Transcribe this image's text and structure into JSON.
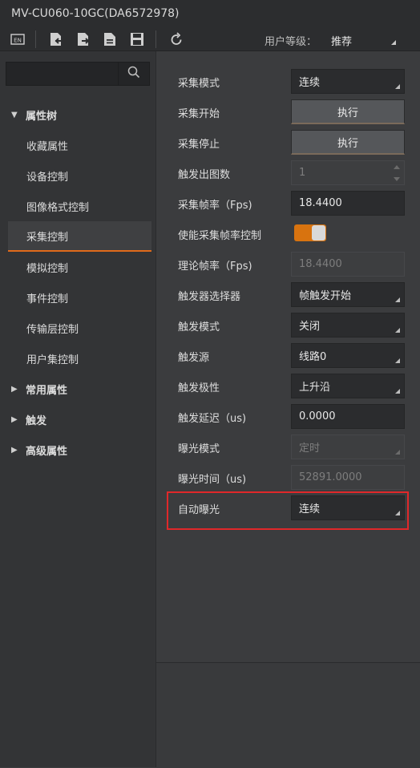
{
  "window": {
    "title": "MV-CU060-10GC(DA6572978)"
  },
  "toolbar": {
    "icons": [
      "en-language-icon",
      "import-icon",
      "export-icon",
      "document-icon",
      "save-icon",
      "refresh-icon"
    ],
    "user_level_label": "用户等级：",
    "user_level_value": "推荐"
  },
  "search": {
    "placeholder": "",
    "value": ""
  },
  "tree": {
    "root_label": "属性树",
    "children": [
      "收藏属性",
      "设备控制",
      "图像格式控制",
      "采集控制",
      "模拟控制",
      "事件控制",
      "传输层控制",
      "用户集控制"
    ],
    "selected": "采集控制",
    "groups": [
      "常用属性",
      "触发",
      "高级属性"
    ]
  },
  "props": [
    {
      "label": "采集模式",
      "type": "combo",
      "value": "连续"
    },
    {
      "label": "采集开始",
      "type": "button",
      "value": "执行"
    },
    {
      "label": "采集停止",
      "type": "button",
      "value": "执行"
    },
    {
      "label": "触发出图数",
      "type": "spin-disabled",
      "value": "1"
    },
    {
      "label": "采集帧率（Fps)",
      "type": "edit",
      "value": "18.4400"
    },
    {
      "label": "使能采集帧率控制",
      "type": "toggle",
      "value": "on"
    },
    {
      "label": "理论帧率（Fps)",
      "type": "edit-disabled",
      "value": "18.4400"
    },
    {
      "label": "触发器选择器",
      "type": "combo",
      "value": "帧触发开始"
    },
    {
      "label": "触发模式",
      "type": "combo",
      "value": "关闭"
    },
    {
      "label": "触发源",
      "type": "combo",
      "value": "线路0"
    },
    {
      "label": "触发极性",
      "type": "combo",
      "value": "上升沿"
    },
    {
      "label": "触发延迟（us)",
      "type": "edit",
      "value": "0.0000"
    },
    {
      "label": "曝光模式",
      "type": "combo-disabled",
      "value": "定时"
    },
    {
      "label": "曝光时间（us)",
      "type": "edit-disabled",
      "value": "52891.0000"
    },
    {
      "label": "自动曝光",
      "type": "combo",
      "value": "连续"
    }
  ],
  "colors": {
    "accent": "#e06a1b",
    "highlight_box": "#e0282a",
    "toggle_on": "#d8730f"
  }
}
